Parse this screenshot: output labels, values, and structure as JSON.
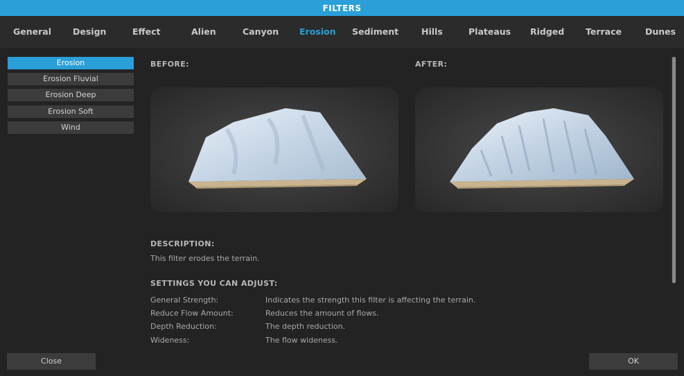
{
  "window": {
    "title": "FILTERS"
  },
  "tabs": [
    {
      "label": "General"
    },
    {
      "label": "Design"
    },
    {
      "label": "Effect"
    },
    {
      "label": "Alien"
    },
    {
      "label": "Canyon"
    },
    {
      "label": "Erosion",
      "active": true
    },
    {
      "label": "Sediment"
    },
    {
      "label": "Hills"
    },
    {
      "label": "Plateaus"
    },
    {
      "label": "Ridged"
    },
    {
      "label": "Terrace"
    },
    {
      "label": "Dunes"
    }
  ],
  "filter_list": {
    "items": [
      "Erosion",
      "Erosion Fluvial",
      "Erosion Deep",
      "Erosion Soft",
      "Wind"
    ],
    "selected": "Erosion"
  },
  "preview": {
    "before_label": "BEFORE:",
    "after_label": "AFTER:"
  },
  "description": {
    "heading": "DESCRIPTION:",
    "text": "This filter erodes the terrain."
  },
  "settings": {
    "heading": "SETTINGS YOU CAN ADJUST:",
    "rows": [
      {
        "name": "General Strength:",
        "desc": "Indicates the strength this filter is affecting the terrain."
      },
      {
        "name": "Reduce Flow Amount:",
        "desc": "Reduces the amount of flows."
      },
      {
        "name": "Depth Reduction:",
        "desc": "The depth reduction."
      },
      {
        "name": "Wideness:",
        "desc": "The flow wideness."
      }
    ]
  },
  "buttons": {
    "close": "Close",
    "ok": "OK"
  },
  "colors": {
    "accent": "#2a9fd8",
    "background": "#232323",
    "tabbar": "#2b2b2b",
    "button": "#3c3c3c"
  }
}
